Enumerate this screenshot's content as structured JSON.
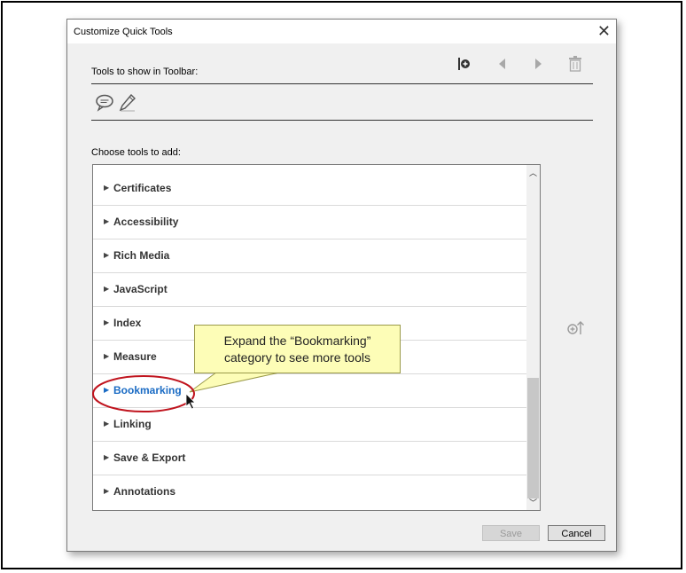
{
  "dialog": {
    "title": "Customize Quick Tools",
    "close_icon": "close-icon",
    "toolbar_label": "Tools to show in Toolbar:",
    "toolbar_actions": [
      "add-separator-icon",
      "move-left-icon",
      "move-right-icon",
      "delete-icon"
    ],
    "toolbar_tools": [
      "comment-icon",
      "pen-icon"
    ],
    "choose_label": "Choose tools to add:",
    "categories": [
      {
        "label": "Certificates"
      },
      {
        "label": "Accessibility"
      },
      {
        "label": "Rich Media"
      },
      {
        "label": "JavaScript"
      },
      {
        "label": "Index"
      },
      {
        "label": "Measure"
      },
      {
        "label": "Bookmarking",
        "highlighted": true
      },
      {
        "label": "Linking"
      },
      {
        "label": "Save & Export"
      },
      {
        "label": "Annotations"
      }
    ],
    "add_to_toolbar_icon": "add-to-toolbar-icon",
    "save_label": "Save",
    "cancel_label": "Cancel"
  },
  "callout": {
    "line1": "Expand the “Bookmarking”",
    "line2": "category to see more tools"
  },
  "colors": {
    "highlight_text": "#1a6bc4",
    "annotation_ring": "#c0141e",
    "callout_bg": "#fdfdb7"
  }
}
